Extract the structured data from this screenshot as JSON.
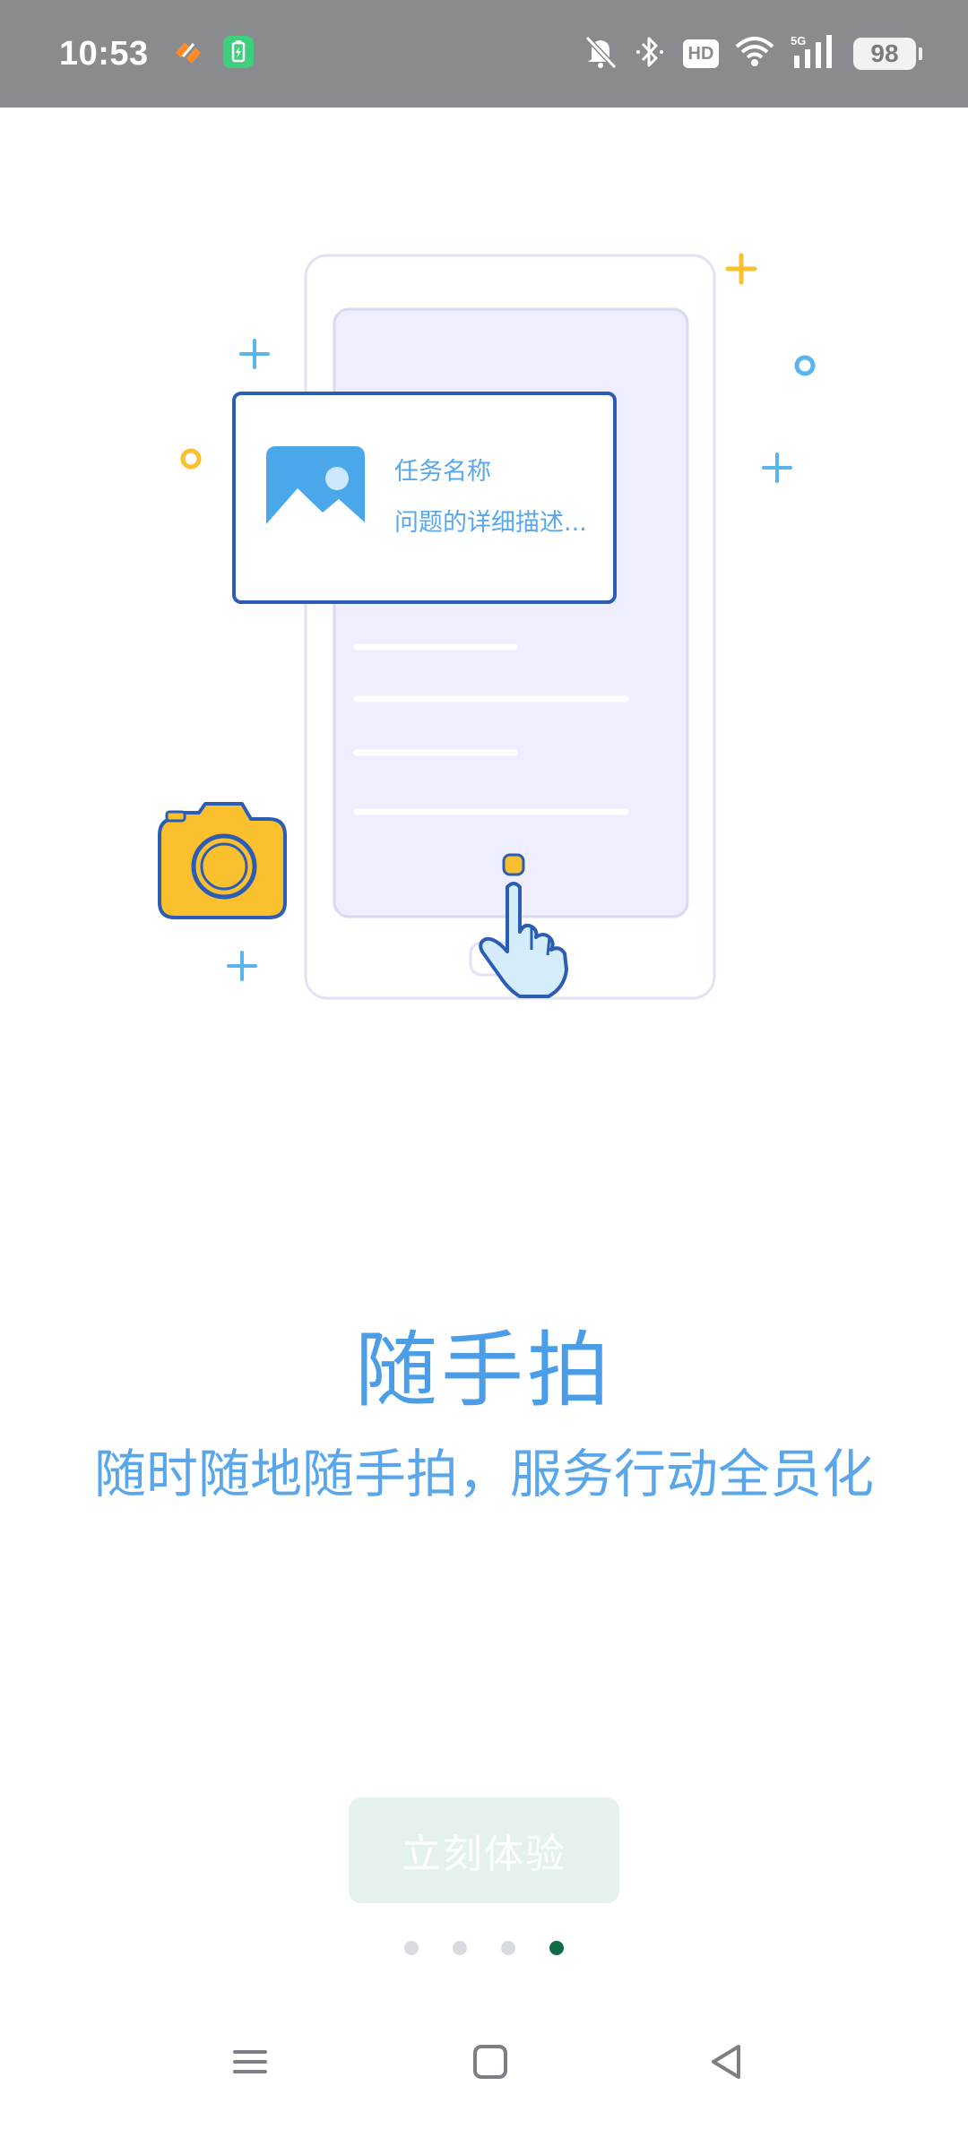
{
  "status_bar": {
    "time": "10:53",
    "hd_label": "HD",
    "battery_level": "98",
    "icons": [
      "app-notification-icon",
      "battery-saver-icon",
      "mute-icon",
      "bluetooth-icon",
      "hd-icon",
      "wifi-icon",
      "5g-signal-icon",
      "battery-icon"
    ]
  },
  "illustration": {
    "card_title": "任务名称",
    "card_desc": "问题的详细描述...",
    "colors": {
      "accent_blue": "#4aa8ea",
      "card_border": "#2c5db4",
      "yellow": "#fbc02d",
      "phone_fill": "#eeeeff"
    }
  },
  "onboarding": {
    "title": "随手拍",
    "subtitle": "随时随地随手拍，服务行动全员化"
  },
  "start_button": {
    "label": "立刻体验"
  },
  "page_indicator": {
    "count": 4,
    "active_index": 3
  },
  "nav_bar": {
    "icons": [
      "menu-icon",
      "home-icon",
      "back-icon"
    ]
  }
}
